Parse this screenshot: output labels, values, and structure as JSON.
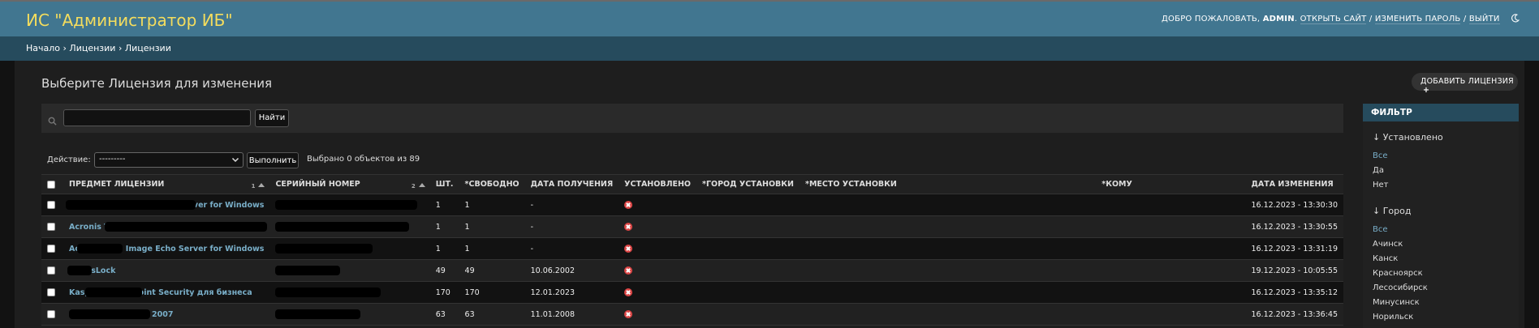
{
  "header": {
    "brand": "ИС \"Администратор ИБ\"",
    "welcome": "ДОБРО ПОЖАЛОВАТЬ,",
    "user": "ADMIN",
    "view_site": "ОТКРЫТЬ САЙТ",
    "change_password": "ИЗМЕНИТЬ ПАРОЛЬ",
    "logout": "ВЫЙТИ",
    "sep": "/",
    "theme_icon": "moon-icon"
  },
  "breadcrumbs": {
    "home": "Начало",
    "app": "Лицензии",
    "model": "Лицензии",
    "sep": "›"
  },
  "page": {
    "title": "Выберите Лицензия для изменения",
    "add_button": "ДОБАВИТЬ ЛИЦЕНЗИЯ"
  },
  "search": {
    "value": "",
    "placeholder": "",
    "button": "Найти"
  },
  "actions": {
    "label": "Действие:",
    "selected": "---------",
    "go": "Выполнить",
    "counter": "Выбрано 0 объектов из 89"
  },
  "table": {
    "columns": [
      "ПРЕДМЕТ ЛИЦЕНЗИИ",
      "СЕРИЙНЫЙ НОМЕР",
      "ШТ.",
      "*СВОБОДНО",
      "ДАТА ПОЛУЧЕНИЯ",
      "УСТАНОВЛЕНО",
      "*ГОРОД УСТАНОВКИ",
      "*МЕСТО УСТАНОВКИ",
      "*КОМУ",
      "ДАТА ИЗМЕНЕНИЯ"
    ],
    "sort_priority": [
      "1",
      "2"
    ],
    "rows": [
      {
        "subject": "Acronis True Image Echo Server for Windows",
        "serial": "",
        "qty": "1",
        "free": "1",
        "received": "-",
        "modified": "16.12.2023 - 13:30:30"
      },
      {
        "subject": "Acronis True Image Echo Server",
        "serial": "",
        "qty": "1",
        "free": "1",
        "received": "-",
        "modified": "16.12.2023 - 13:30:55"
      },
      {
        "subject": "Acronis True Image Echo Server for Windows",
        "serial": "",
        "qty": "1",
        "free": "1",
        "received": "-",
        "modified": "16.12.2023 - 13:31:19"
      },
      {
        "subject": "DallasLock",
        "serial": "",
        "qty": "49",
        "free": "49",
        "received": "10.06.2002",
        "modified": "19.12.2023 - 10:05:55"
      },
      {
        "subject": "Kaspersky Endpoint Security для бизнеса",
        "serial": "",
        "qty": "170",
        "free": "170",
        "received": "12.01.2023",
        "modified": "16.12.2023 - 13:35:12"
      },
      {
        "subject": "2007",
        "serial": "",
        "qty": "63",
        "free": "63",
        "received": "11.01.2008",
        "modified": "16.12.2023 - 13:36:45"
      }
    ]
  },
  "filter": {
    "title": "ФИЛЬТР",
    "installed": {
      "heading": "↓ Установлено",
      "options": [
        "Все",
        "Да",
        "Нет"
      ]
    },
    "city": {
      "heading": "↓ Город",
      "options": [
        "Все",
        "Ачинск",
        "Канск",
        "Красноярск",
        "Лесосибирск",
        "Минусинск",
        "Норильск"
      ]
    }
  },
  "colors": {
    "header_bg": "#417690",
    "breadcrumbs_bg": "#264b5d",
    "brand_text": "#f5dd5d",
    "link": "#79aec8",
    "no_icon": "#dd4646",
    "page_bg": "#121212",
    "content_bg": "#1e1e1e"
  }
}
